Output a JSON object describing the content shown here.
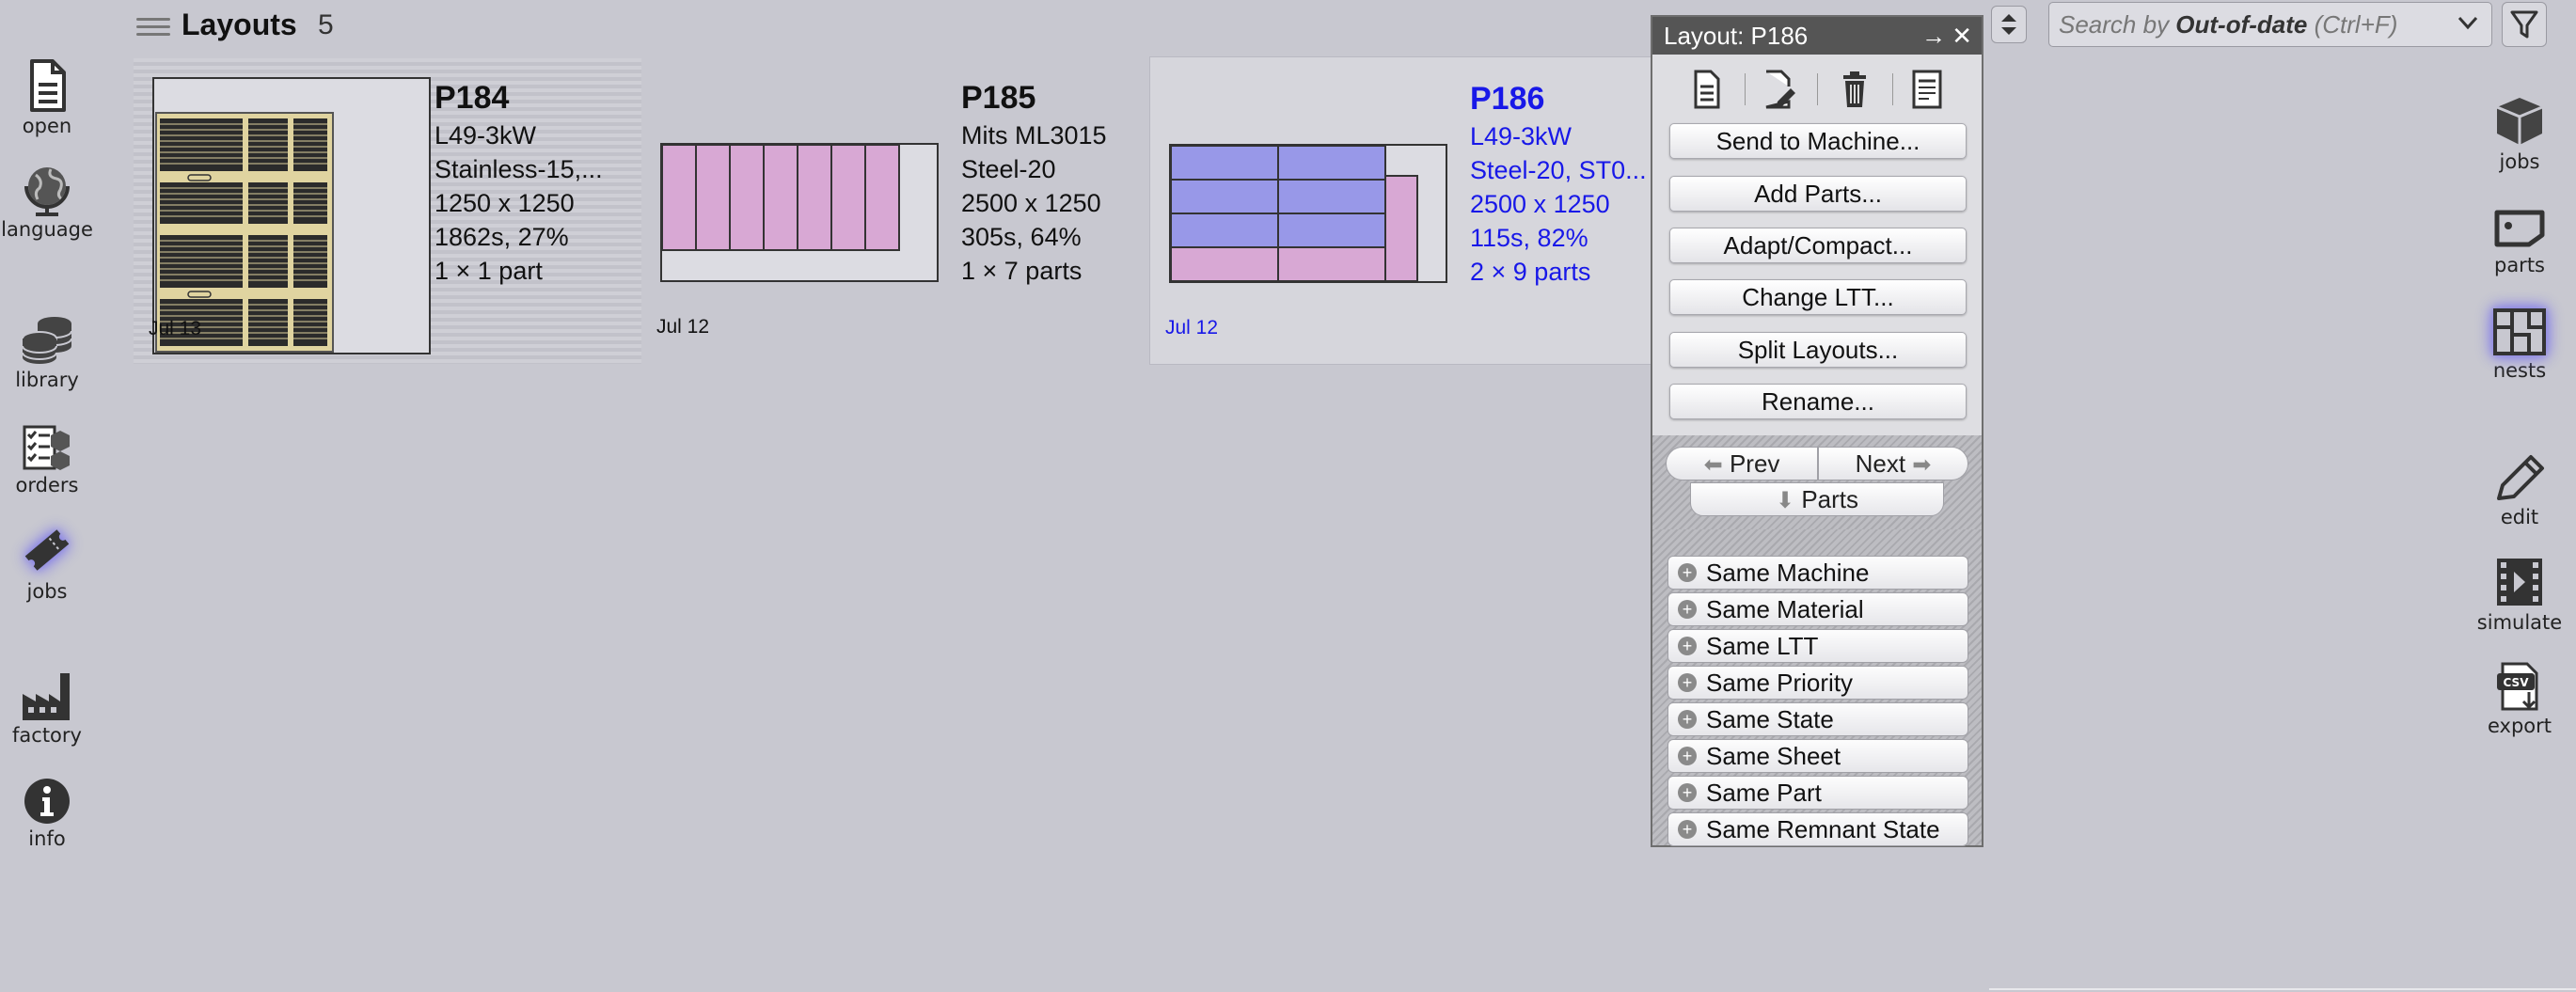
{
  "left_nav": [
    {
      "label": "open",
      "icon": "document-icon"
    },
    {
      "label": "language",
      "icon": "globe-icon"
    },
    {
      "label": "library",
      "icon": "database-icon"
    },
    {
      "label": "orders",
      "icon": "checklist-icon"
    },
    {
      "label": "jobs",
      "icon": "ticket-icon",
      "active": true
    },
    {
      "label": "factory",
      "icon": "factory-icon"
    },
    {
      "label": "info",
      "icon": "info-icon"
    }
  ],
  "right_nav": [
    {
      "label": "jobs",
      "icon": "box-icon"
    },
    {
      "label": "parts",
      "icon": "part-icon"
    },
    {
      "label": "nests",
      "icon": "nests-icon",
      "active": true
    },
    {
      "label": "edit",
      "icon": "pencil-icon"
    },
    {
      "label": "simulate",
      "icon": "film-icon"
    },
    {
      "label": "export",
      "icon": "csv-export-icon"
    }
  ],
  "header": {
    "title": "Layouts",
    "count": "5"
  },
  "cards": [
    {
      "name": "P184",
      "machine": "L49-3kW",
      "material": "Stainless-15,...",
      "size": "1250 x 1250",
      "time": "1862s, 27%",
      "parts": "1 × 1 part",
      "date": "Jul 13"
    },
    {
      "name": "P185",
      "machine": "Mits ML3015",
      "material": "Steel-20",
      "size": "2500 x 1250",
      "time": "305s, 64%",
      "parts": "1 × 7 parts",
      "date": "Jul 12"
    },
    {
      "name": "P186",
      "machine": "L49-3kW",
      "material": "Steel-20, ST0...",
      "size": "2500 x 1250",
      "time": "115s, 82%",
      "parts": "2 × 9 parts",
      "date": "Jul 12",
      "selected": true
    }
  ],
  "panel": {
    "title": "Layout: P186",
    "buttons": [
      "Send to Machine...",
      "Add Parts...",
      "Adapt/Compact...",
      "Change LTT...",
      "Split Layouts...",
      "Rename..."
    ],
    "nav": {
      "prev": "Prev",
      "next": "Next",
      "parts": "Parts"
    },
    "filters": [
      "Same Machine",
      "Same Material",
      "Same LTT",
      "Same Priority",
      "Same State",
      "Same Sheet",
      "Same Part",
      "Same Remnant State"
    ]
  },
  "search": {
    "prefix": "Search by ",
    "field": "Out-of-date",
    "shortcut": " (Ctrl+F)"
  },
  "colors": {
    "accent_blue": "#1818e8",
    "part_pink": "#d8a8d4",
    "part_blue": "#9898e8",
    "sheet_tan": "#e0d4a0"
  }
}
